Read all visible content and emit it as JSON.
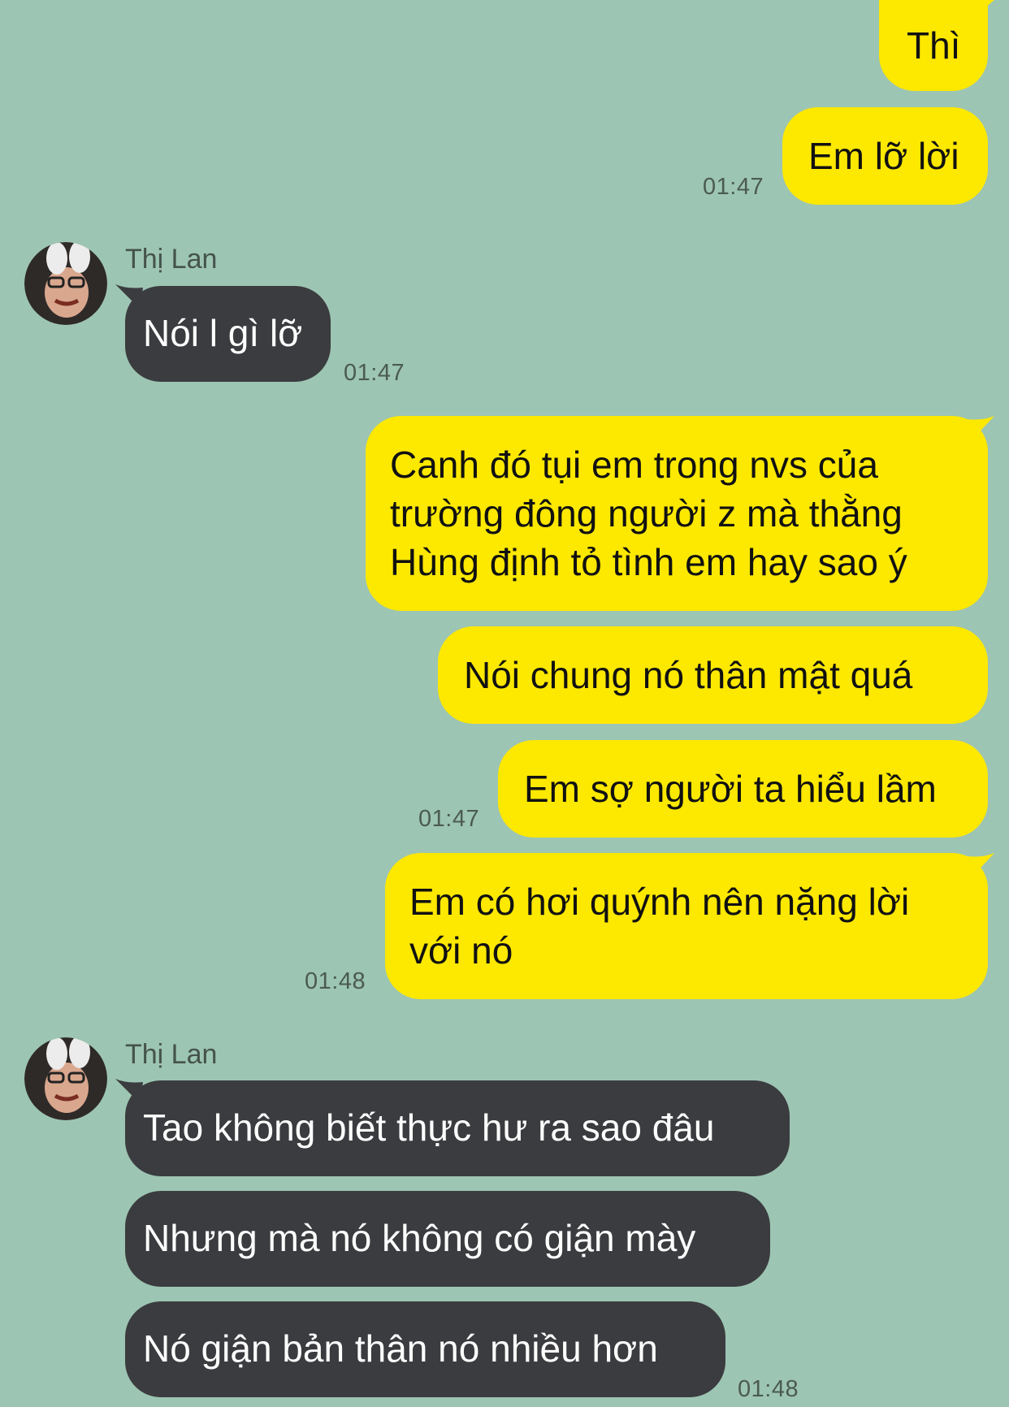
{
  "colors": {
    "background": "#9dc5b3",
    "outgoing_bubble": "#fde800",
    "incoming_bubble": "#3b3c3f",
    "timestamp": "#4b5a54"
  },
  "messages": {
    "m1": {
      "text": "Thì"
    },
    "m2": {
      "text": "Em lỡ lời",
      "time": "01:47"
    },
    "g1": {
      "sender": "Thị Lan",
      "avatar_icon": "user-avatar-icon",
      "m1": {
        "text": "Nói l gì lỡ",
        "time": "01:47"
      }
    },
    "m3": {
      "lines": [
        "Canh đó tụi em trong nvs của",
        "trường đông người z mà thằng",
        "Hùng định tỏ tình em hay sao ý"
      ]
    },
    "m4": {
      "text": "Nói chung nó thân mật quá"
    },
    "m5": {
      "text": "Em sợ người ta hiểu lầm",
      "time": "01:47"
    },
    "m6": {
      "lines": [
        "Em có hơi quýnh nên nặng lời",
        "với nó"
      ],
      "time": "01:48"
    },
    "g2": {
      "sender": "Thị Lan",
      "avatar_icon": "user-avatar-icon",
      "m1": {
        "text": "Tao không biết thực hư ra sao đâu"
      },
      "m2": {
        "text": "Nhưng mà nó không có giận mày"
      },
      "m3": {
        "text": "Nó giận bản thân nó nhiều hơn",
        "time": "01:48"
      }
    }
  }
}
